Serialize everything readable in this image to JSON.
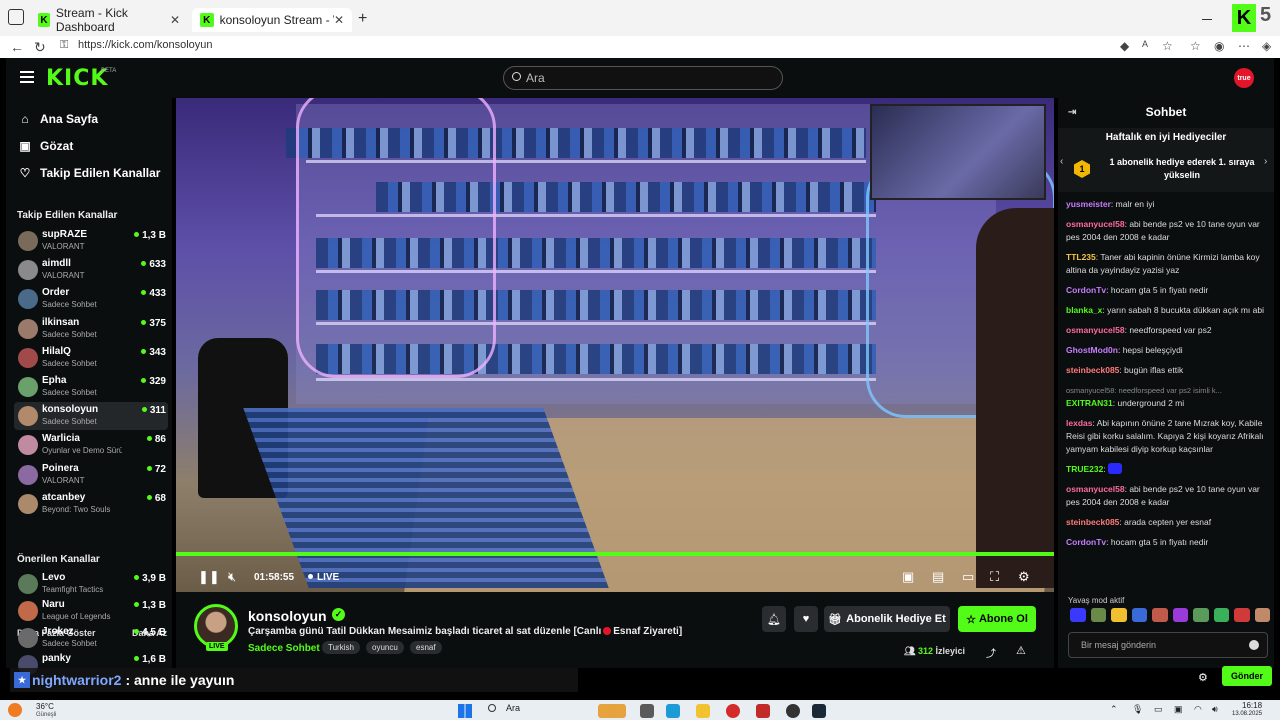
{
  "browser": {
    "tabs": [
      {
        "title": "Stream - Kick Dashboard",
        "active": false
      },
      {
        "title": "konsoloyun Stream - Watch Live o",
        "active": true
      }
    ],
    "url": "https://kick.com/konsoloyun",
    "corner_number": "5"
  },
  "topnav": {
    "logo": "KICK",
    "beta": "BETA",
    "search_placeholder": "Ara",
    "avatar_text": "true"
  },
  "sidebar": {
    "nav": [
      {
        "label": "Ana Sayfa",
        "icon": "home-icon"
      },
      {
        "label": "Gözat",
        "icon": "browse-icon"
      },
      {
        "label": "Takip Edilen Kanallar",
        "icon": "heart-icon"
      }
    ],
    "followed_title": "Takip Edilen Kanallar",
    "followed": [
      {
        "name": "supRAZE",
        "sub": "VALORANT",
        "count": "1,3 B",
        "color": "#7a6a5a"
      },
      {
        "name": "aimdll",
        "sub": "VALORANT",
        "count": "633",
        "color": "#8a8a8a"
      },
      {
        "name": "Order",
        "sub": "Sadece Sohbet",
        "count": "433",
        "color": "#4a6a8a"
      },
      {
        "name": "ilkinsan",
        "sub": "Sadece Sohbet",
        "count": "375",
        "color": "#9a7a6a"
      },
      {
        "name": "HilalQ",
        "sub": "Sadece Sohbet",
        "count": "343",
        "color": "#a04a4a"
      },
      {
        "name": "Epha",
        "sub": "Sadece Sohbet",
        "count": "329",
        "color": "#6aa06a"
      },
      {
        "name": "konsoloyun",
        "sub": "Sadece Sohbet",
        "count": "311",
        "color": "#b08a6a",
        "selected": true
      },
      {
        "name": "Warlicia",
        "sub": "Oyunlar ve Demo Sürü...",
        "count": "86",
        "color": "#c08aa0"
      },
      {
        "name": "Poinera",
        "sub": "VALORANT",
        "count": "72",
        "color": "#8a6aa0"
      },
      {
        "name": "atcanbey",
        "sub": "Beyond: Two Souls",
        "count": "68",
        "color": "#aa8a6a"
      }
    ],
    "show_more": "Daha Fazla Göster",
    "show_less": "Daha Az",
    "recommended_title": "Önerilen Kanallar",
    "recommended": [
      {
        "name": "Levo",
        "sub": "Teamfight Tactics",
        "count": "3,9 B",
        "color": "#5a7a5a"
      },
      {
        "name": "Naru",
        "sub": "League of Legends",
        "count": "1,3 B",
        "color": "#c06a4a"
      },
      {
        "name": "Jrokez",
        "sub": "Sadece Sohbet",
        "count": "4,5 B",
        "color": "#6a6a6a"
      },
      {
        "name": "panky",
        "sub": "",
        "count": "1,6 B",
        "color": "#4a4a6a"
      }
    ]
  },
  "player": {
    "time": "01:58:55",
    "live_label": "LIVE"
  },
  "stream": {
    "streamer": "konsoloyun",
    "live_badge": "LIVE",
    "title_before": "Çarşamba günü Tatil Dükkan Mesaimiz başladı ticaret al sat düzenle [Canlı",
    "title_after": "Esnaf Ziyareti]",
    "category": "Sadece Sohbet",
    "tags": [
      "Turkish",
      "oyuncu",
      "esnaf"
    ],
    "gift_label": "Abonelik Hediye Et",
    "subscribe_label": "Abone Ol",
    "viewers": "312",
    "viewers_label": "İzleyici"
  },
  "caption": {
    "user": "nightwarrior2",
    "text": ": anne ile yayuın"
  },
  "chat": {
    "title": "Sohbet",
    "gifters_title": "Haftalık en iyi Hediyeciler",
    "gifters_rank": "1",
    "gifters_desc": "1 abonelik hediye ederek 1. sıraya yükselin",
    "messages": [
      {
        "user": "yusmeister",
        "color": "#c77dff",
        "text": "malr en iyi"
      },
      {
        "user": "osmanyucel58",
        "color": "#ff6b9a",
        "text": "abi bende ps2 ve 10 tane oyun var pes 2004 den 2008 e kadar"
      },
      {
        "user": "TTL235",
        "color": "#f5c542",
        "text": "Taner abi kapinin önüne Kirmizi lamba koy altina da yayindayiz yazisi yaz"
      },
      {
        "user": "CordonTv",
        "color": "#c77dff",
        "text": "hocam gta 5 in fiyatı nedir"
      },
      {
        "user": "blanka_x",
        "color": "#53fc18",
        "text": "yarın sabah 8 bucukta dükkan açık mı abi"
      },
      {
        "user": "osmanyucel58",
        "color": "#ff6b9a",
        "text": "needforspeed var ps2"
      },
      {
        "user": "GhostMod0n",
        "color": "#c77dff",
        "text": "hepsi beleşçiydi"
      },
      {
        "user": "steinbeck085",
        "color": "#ff7a7a",
        "text": "bugün iflas ettik"
      },
      {
        "reply": "osmanyucel58: needforspeed var ps2 isimli k...",
        "user": "EXITRAN31",
        "color": "#53fc18",
        "text": "underground 2 mi"
      },
      {
        "user": "lexdas",
        "color": "#ff6b9a",
        "text": "Abi kapının önüne 2 tane Mızrak koy, Kabile Reisi gibi korku salalım. Kapıya 2 kişi koyarız Afrikalı yamyam kabilesi diyip korkup kaçsınlar"
      },
      {
        "user": "TRUE232",
        "color": "#53fc18",
        "text": ""
      },
      {
        "user": "osmanyucel58",
        "color": "#ff6b9a",
        "text": "abi bende ps2 ve 10 tane oyun var pes 2004 den 2008 e kadar"
      },
      {
        "user": "steinbeck085",
        "color": "#ff7a7a",
        "text": "arada cepten yer esnaf"
      },
      {
        "user": "CordonTv",
        "color": "#c77dff",
        "text": "hocam gta 5 in fiyatı nedir"
      }
    ],
    "slow_mode": "Yavaş mod aktif",
    "input_placeholder": "Bir mesaj gönderin",
    "send_label": "Gönder"
  },
  "taskbar": {
    "temp": "36°C",
    "weather": "Güneşli",
    "search": "Ara",
    "time": "16:18",
    "date": "13.08.2025"
  },
  "colors": {
    "accent": "#53fc18",
    "bg": "#0b0e0f"
  }
}
